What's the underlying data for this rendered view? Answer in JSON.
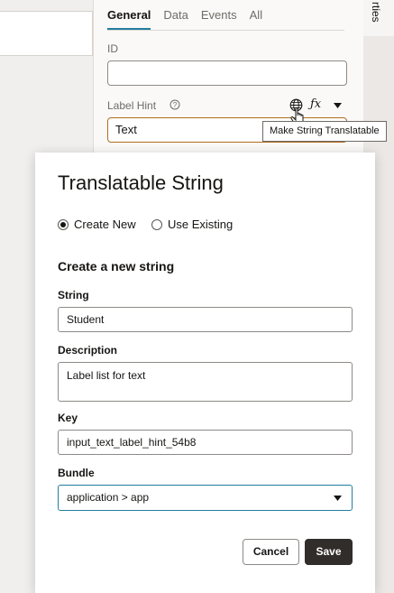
{
  "properties_panel": {
    "tabs": [
      {
        "label": "General",
        "active": true
      },
      {
        "label": "Data",
        "active": false
      },
      {
        "label": "Events",
        "active": false
      },
      {
        "label": "All",
        "active": false
      }
    ],
    "id_label": "ID",
    "id_value": "",
    "label_hint_label": "Label Hint",
    "label_hint_value": "Text",
    "side_tab_label": "rties"
  },
  "tooltip": {
    "text": "Make String Translatable"
  },
  "dialog": {
    "title": "Translatable String",
    "radio_create_new": "Create New",
    "radio_use_existing": "Use Existing",
    "selected_radio": "Create New",
    "section_title": "Create a new string",
    "string_label": "String",
    "string_value": "Student",
    "description_label": "Description",
    "description_value": "Label list for text",
    "key_label": "Key",
    "key_value": "input_text_label_hint_54b8",
    "bundle_label": "Bundle",
    "bundle_value": "application > app",
    "cancel_label": "Cancel",
    "save_label": "Save"
  },
  "icons": {
    "help": "help-circle-icon",
    "globe": "globe-icon",
    "fx": "fx-icon",
    "caret": "chevron-down-icon",
    "cursor": "hand-pointer-icon"
  },
  "colors": {
    "accent": "#227e9e",
    "focus_border": "#b06e22",
    "primary_button": "#312d2a"
  }
}
